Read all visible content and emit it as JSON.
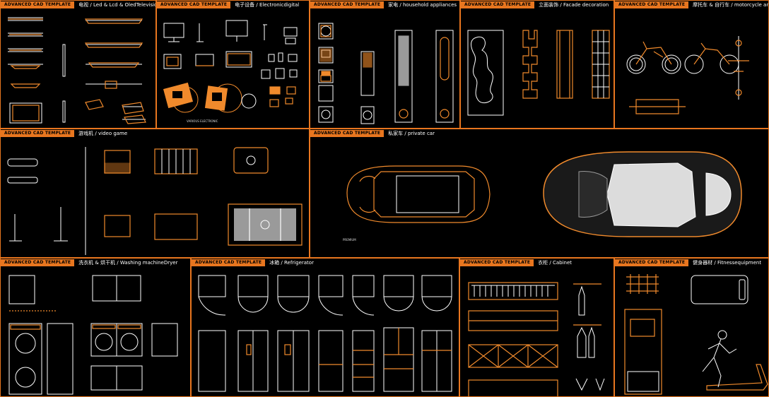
{
  "header_tag": "ADVANCED CAD TEMPLATE",
  "panels": {
    "led": {
      "tag": "ADVANCED CAD TEMPLATE",
      "title": "电视 / Led & Lcd & OledTelevision"
    },
    "electronic": {
      "tag": "ADVANCED CAD TEMPLATE",
      "title": "电子设备 / Electronicdigital",
      "caption": "VARIOUS ELECTRONIC"
    },
    "household": {
      "tag": "ADVANCED CAD TEMPLATE",
      "title": "家电 / household appliances"
    },
    "facade": {
      "tag": "ADVANCED CAD TEMPLATE",
      "title": "立面装饰 / Facade decoration"
    },
    "motorcycle": {
      "tag": "ADVANCED CAD TEMPLATE",
      "title": "摩托车 & 自行车 / motorcycle and bicycle"
    },
    "videogame": {
      "tag": "ADVANCED CAD TEMPLATE",
      "title": "游戏机 / video game"
    },
    "privatecar": {
      "tag": "ADVANCED CAD TEMPLATE",
      "title": "私家车 / private car",
      "caption": "PREMIUM"
    },
    "washing": {
      "tag": "ADVANCED CAD TEMPLATE",
      "title": "洗衣机 & 烘干机 / Washing machineDryer"
    },
    "fridge": {
      "tag": "ADVANCED CAD TEMPLATE",
      "title": "冰箱 / Refrigerator"
    },
    "cabinet": {
      "tag": "ADVANCED CAD TEMPLATE",
      "title": "衣柜 / Cabinet"
    },
    "fitness": {
      "tag": "ADVANCED CAD TEMPLATE",
      "title": "健身器材 / Fitnessequipment"
    }
  },
  "colors": {
    "accent": "#e8761f",
    "line": "#f08a2c",
    "background": "#000000",
    "text": "#ffffff"
  }
}
